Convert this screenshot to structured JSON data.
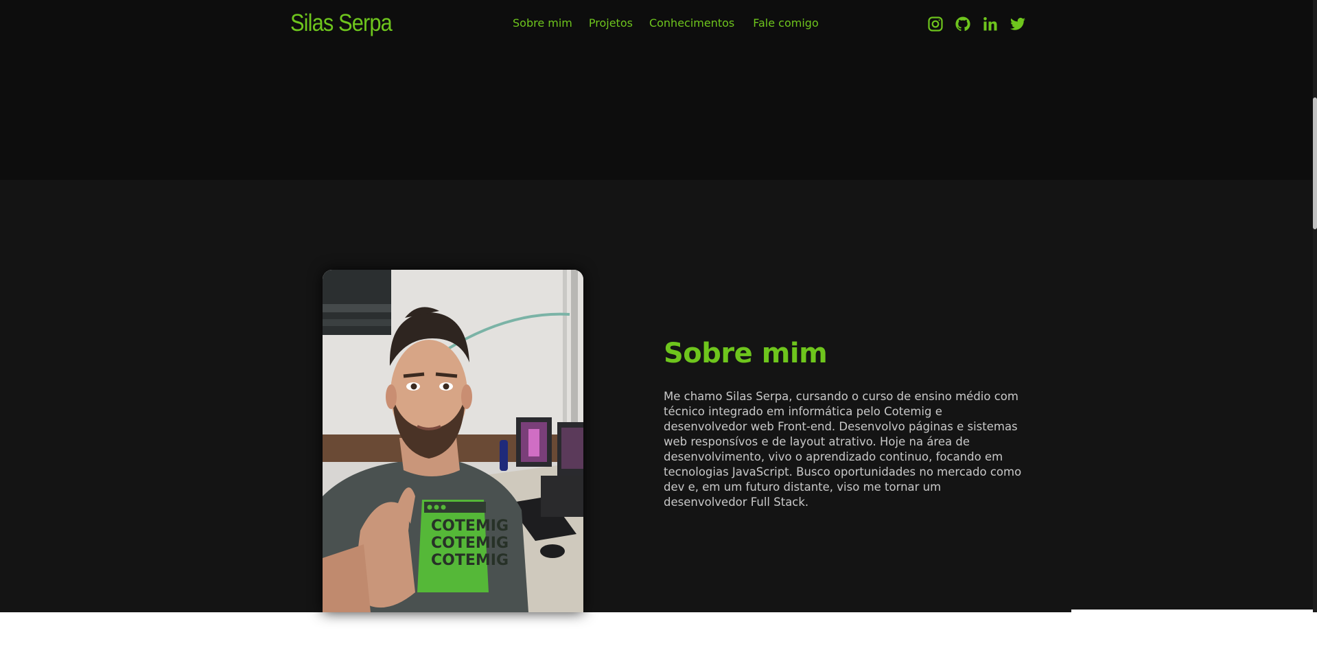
{
  "header": {
    "brand": "Silas Serpa",
    "nav": [
      {
        "label": "Sobre mim"
      },
      {
        "label": "Projetos"
      },
      {
        "label": "Conhecimentos"
      },
      {
        "label": "Fale comigo"
      }
    ],
    "socials": [
      "instagram-icon",
      "github-icon",
      "linkedin-icon",
      "twitter-icon"
    ]
  },
  "about": {
    "title": "Sobre mim",
    "text": "Me chamo Silas Serpa, cursando o curso de ensino médio com técnico integrado em informática pelo Cotemig e desenvolvedor web Front-end. Desenvolvo páginas e sistemas web responsívos e de layout atrativo. Hoje na área de desenvolvimento, vivo o aprendizado continuo, focando em tecnologias JavaScript. Busco oportunidades no mercado como dev e, em um futuro distante, viso me tornar um desenvolvedor Full Stack.",
    "photo_shirt_text": "COTEMIG"
  },
  "colors": {
    "accent": "#6ec51d",
    "background_dark": "#0d0d0d",
    "background_section": "#141414",
    "text": "#c9c9c9"
  }
}
